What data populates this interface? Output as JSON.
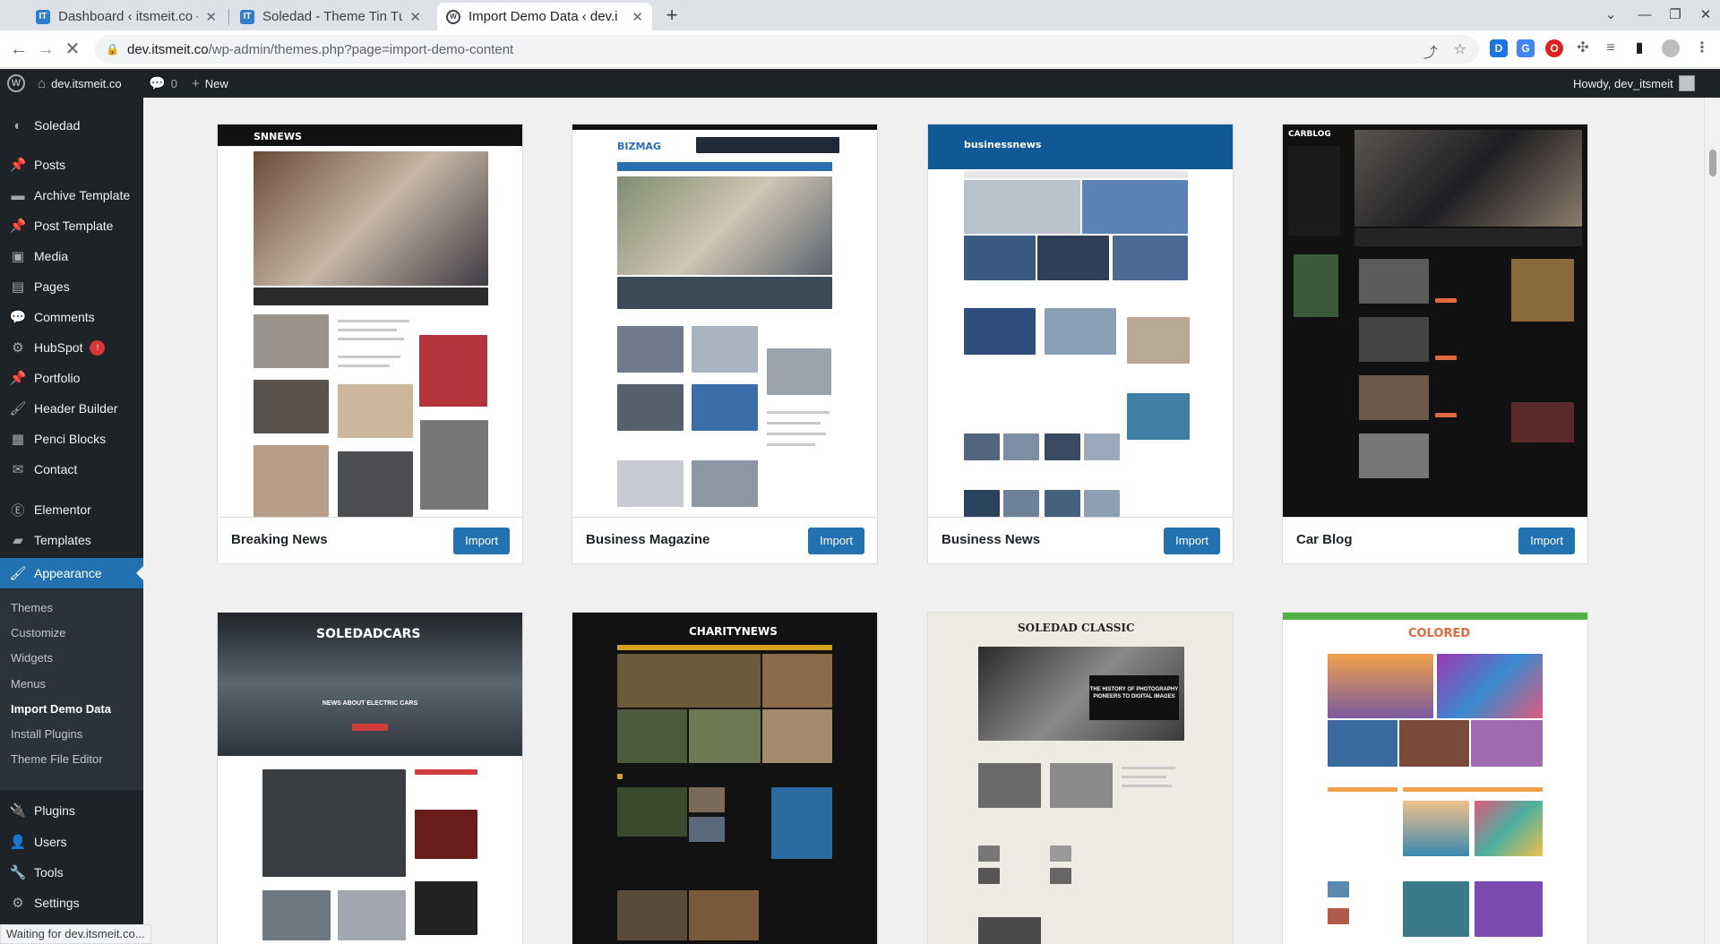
{
  "browser": {
    "tabs": [
      {
        "title": "Dashboard ‹ itsmeit.co —",
        "icon": "IT"
      },
      {
        "title": "Soledad - Theme Tin Tức",
        "icon": "IT"
      },
      {
        "title": "Import Demo Data ‹ dev.i",
        "icon": "wp"
      }
    ],
    "url_host": "dev.itsmeit.co",
    "url_path": "/wp-admin/themes.php?page=import-demo-content",
    "status_text": "Waiting for dev.itsmeit.co..."
  },
  "adminbar": {
    "site_name": "dev.itsmeit.co",
    "comments_count": "0",
    "new_label": "New",
    "howdy": "Howdy, dev_itsmeit"
  },
  "sidebar": {
    "items": [
      {
        "label": "Soledad",
        "icon": "soledad-icon"
      },
      {
        "label": "Posts",
        "icon": "pin-icon"
      },
      {
        "label": "Archive Template",
        "icon": "archive-icon"
      },
      {
        "label": "Post Template",
        "icon": "pin-icon"
      },
      {
        "label": "Media",
        "icon": "media-icon"
      },
      {
        "label": "Pages",
        "icon": "pages-icon"
      },
      {
        "label": "Comments",
        "icon": "comments-icon"
      },
      {
        "label": "HubSpot",
        "icon": "hubspot-icon",
        "badge": "!"
      },
      {
        "label": "Portfolio",
        "icon": "pin-icon"
      },
      {
        "label": "Header Builder",
        "icon": "brush-icon"
      },
      {
        "label": "Penci Blocks",
        "icon": "blocks-icon"
      },
      {
        "label": "Contact",
        "icon": "mail-icon"
      },
      {
        "label": "Elementor",
        "icon": "elementor-icon"
      },
      {
        "label": "Templates",
        "icon": "folder-icon"
      },
      {
        "label": "Appearance",
        "icon": "brush-icon"
      },
      {
        "label": "Plugins",
        "icon": "plugin-icon"
      },
      {
        "label": "Users",
        "icon": "user-icon"
      },
      {
        "label": "Tools",
        "icon": "wrench-icon"
      },
      {
        "label": "Settings",
        "icon": "settings-icon"
      }
    ],
    "submenu": [
      "Themes",
      "Customize",
      "Widgets",
      "Menus",
      "Import Demo Data",
      "Install Plugins",
      "Theme File Editor"
    ]
  },
  "demos": [
    {
      "title": "Breaking News",
      "button": "Import",
      "logo": "SNNEWS"
    },
    {
      "title": "Business Magazine",
      "button": "Import",
      "logo": "BIZMAG"
    },
    {
      "title": "Business News",
      "button": "Import",
      "logo": "businessnews"
    },
    {
      "title": "Car Blog",
      "button": "Import",
      "logo": "CARBLOG"
    },
    {
      "title": "",
      "button": "",
      "logo": "SOLEDADCARS",
      "subtitle": "NEWS ABOUT ELECTRIC CARS"
    },
    {
      "title": "",
      "button": "",
      "logo": "CHARITYNEWS"
    },
    {
      "title": "",
      "button": "",
      "logo": "SOLEDAD CLASSIC",
      "subtitle": "THE HISTORY OF PHOTOGRAPHY PIONEERS TO DIGITAL IMAGES"
    },
    {
      "title": "",
      "button": "",
      "logo": "COLORED"
    }
  ],
  "colors": {
    "accent": "#2271b1",
    "sidebar_bg": "#1d2327",
    "badge": "#d63638"
  }
}
